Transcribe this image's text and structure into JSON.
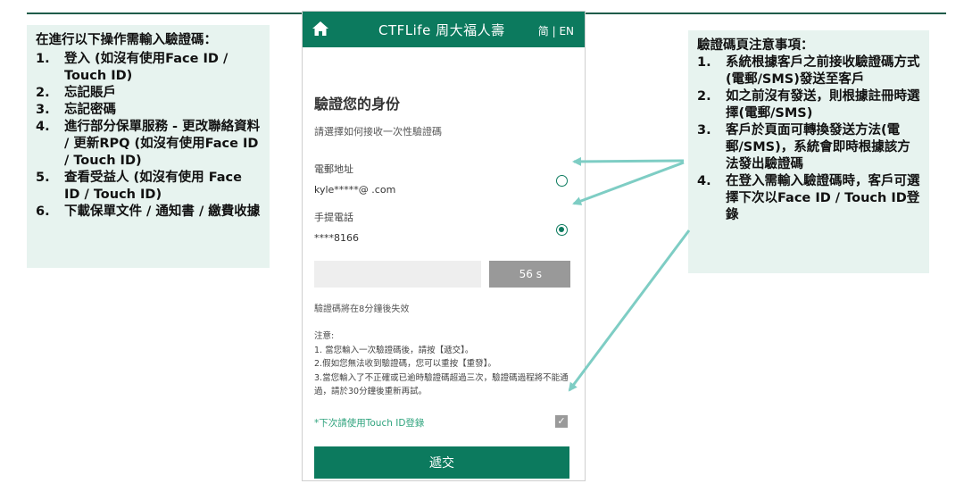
{
  "left_note": {
    "heading": "在進行以下操作需輸入驗證碼：",
    "items": [
      {
        "num": "1.",
        "text": "登入 (如沒有使用Face ID / Touch ID)"
      },
      {
        "num": "2.",
        "text": "忘記賬戶"
      },
      {
        "num": "3.",
        "text": "忘記密碼"
      },
      {
        "num": "4.",
        "text": "進行部分保單服務 - 更改聯絡資料 / 更新RPQ (如沒有使用Face ID / Touch ID)"
      },
      {
        "num": "5.",
        "text": "查看受益人 (如沒有使用 Face ID / Touch ID)"
      },
      {
        "num": "6.",
        "text": "下載保單文件 / 通知書 / 繳費收據"
      }
    ]
  },
  "right_note": {
    "heading": "驗證碼頁注意事項：",
    "items": [
      {
        "num": "1.",
        "text": "系統根據客戶之前接收驗證碼方式(電郵/SMS)發送至客戶"
      },
      {
        "num": "2.",
        "text": "如之前沒有發送，則根據註冊時選擇(電郵/SMS)"
      },
      {
        "num": "3.",
        "text": "客戶於頁面可轉換發送方法(電郵/SMS)，系統會即時根據該方法發出驗證碼"
      },
      {
        "num": "4.",
        "text": "在登入需輸入驗證碼時，客戶可選擇下次以Face ID / Touch ID登錄"
      }
    ]
  },
  "app": {
    "brand": "CTFLife 周大福人壽",
    "lang_toggle": "简 | EN",
    "home_icon": "home-icon",
    "title": "驗證您的身份",
    "subtitle": "請選擇如何接收一次性驗證碼",
    "email_label": "電郵地址",
    "email_value": "kyle*****@          .com",
    "email_selected": false,
    "phone_label": "手提電話",
    "phone_value": "****8166",
    "phone_selected": true,
    "code_placeholder": "",
    "resend_label": "56 s",
    "expire_text": "驗證碼將在8分鐘後失效",
    "notes": [
      "注意:",
      "1. 當您輸入一次驗證碼後，請按【遞交】。",
      "2.假如您無法收到驗證碼，您可以重按【重發】。",
      "3.當您輸入了不正確或已逾時驗證碼超過三次，驗證碼過程將不能通過，請於30分鐘後重新再試。"
    ],
    "touch_id_label": "*下次請使用Touch ID登錄",
    "touch_id_checked": true,
    "submit_label": "遞交"
  },
  "colors": {
    "brand_green": "#0c7a5e",
    "panel_bg": "#e7f3ef",
    "arrow": "#7ecdc4"
  }
}
